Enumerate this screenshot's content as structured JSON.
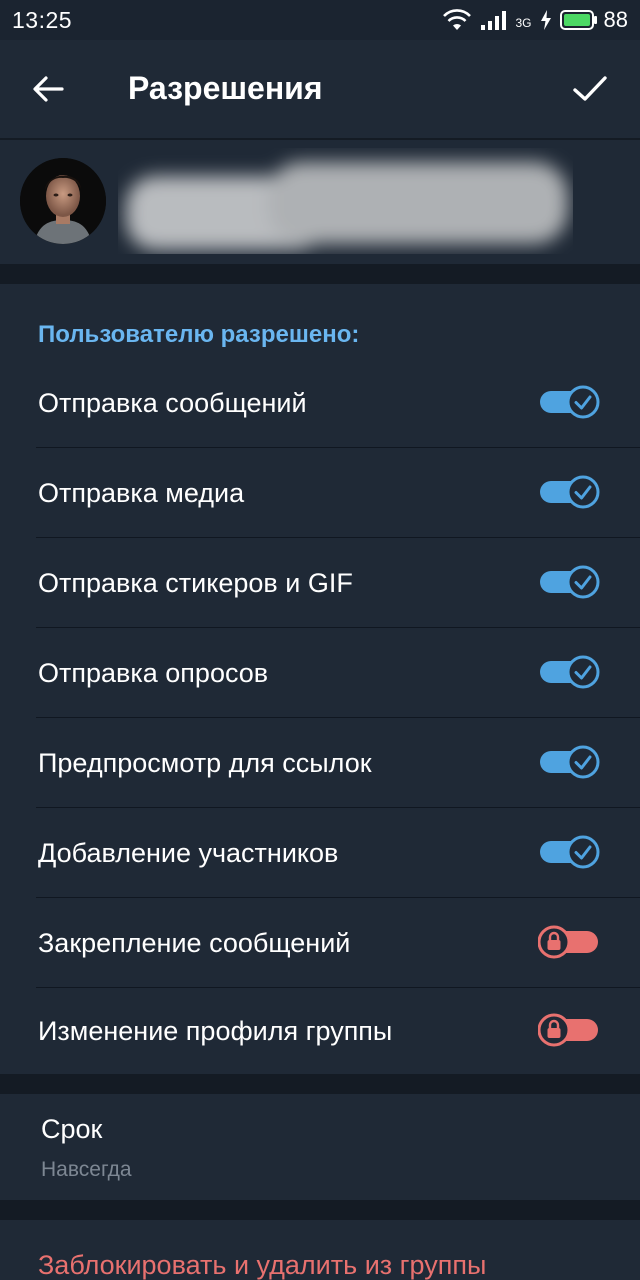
{
  "status_bar": {
    "time": "13:25",
    "network_type": "3G",
    "battery_percent": "88",
    "icons": [
      "wifi-icon",
      "signal-icon",
      "charging-icon",
      "battery-icon"
    ]
  },
  "header": {
    "title": "Разрешения",
    "back_icon": "arrow-left-icon",
    "confirm_icon": "checkmark-icon"
  },
  "user": {
    "avatar_icon": "user-avatar",
    "name_redacted": true
  },
  "permissions": {
    "section_title": "Пользователю разрешено:",
    "items": [
      {
        "label": "Отправка сообщений",
        "state": "on"
      },
      {
        "label": "Отправка медиа",
        "state": "on"
      },
      {
        "label": "Отправка стикеров и GIF",
        "state": "on"
      },
      {
        "label": "Отправка опросов",
        "state": "on"
      },
      {
        "label": "Предпросмотр для ссылок",
        "state": "on"
      },
      {
        "label": "Добавление участников",
        "state": "on"
      },
      {
        "label": "Закрепление сообщений",
        "state": "locked"
      },
      {
        "label": "Изменение профиля группы",
        "state": "locked"
      }
    ]
  },
  "duration": {
    "label": "Срок",
    "value": "Навсегда"
  },
  "danger": {
    "label": "Заблокировать и удалить из группы"
  },
  "colors": {
    "accent": "#6ab6f0",
    "toggle_on": "#4fa3e0",
    "toggle_locked": "#e8716f",
    "panel": "#1f2936",
    "background": "#141b24",
    "danger": "#e8716f"
  }
}
